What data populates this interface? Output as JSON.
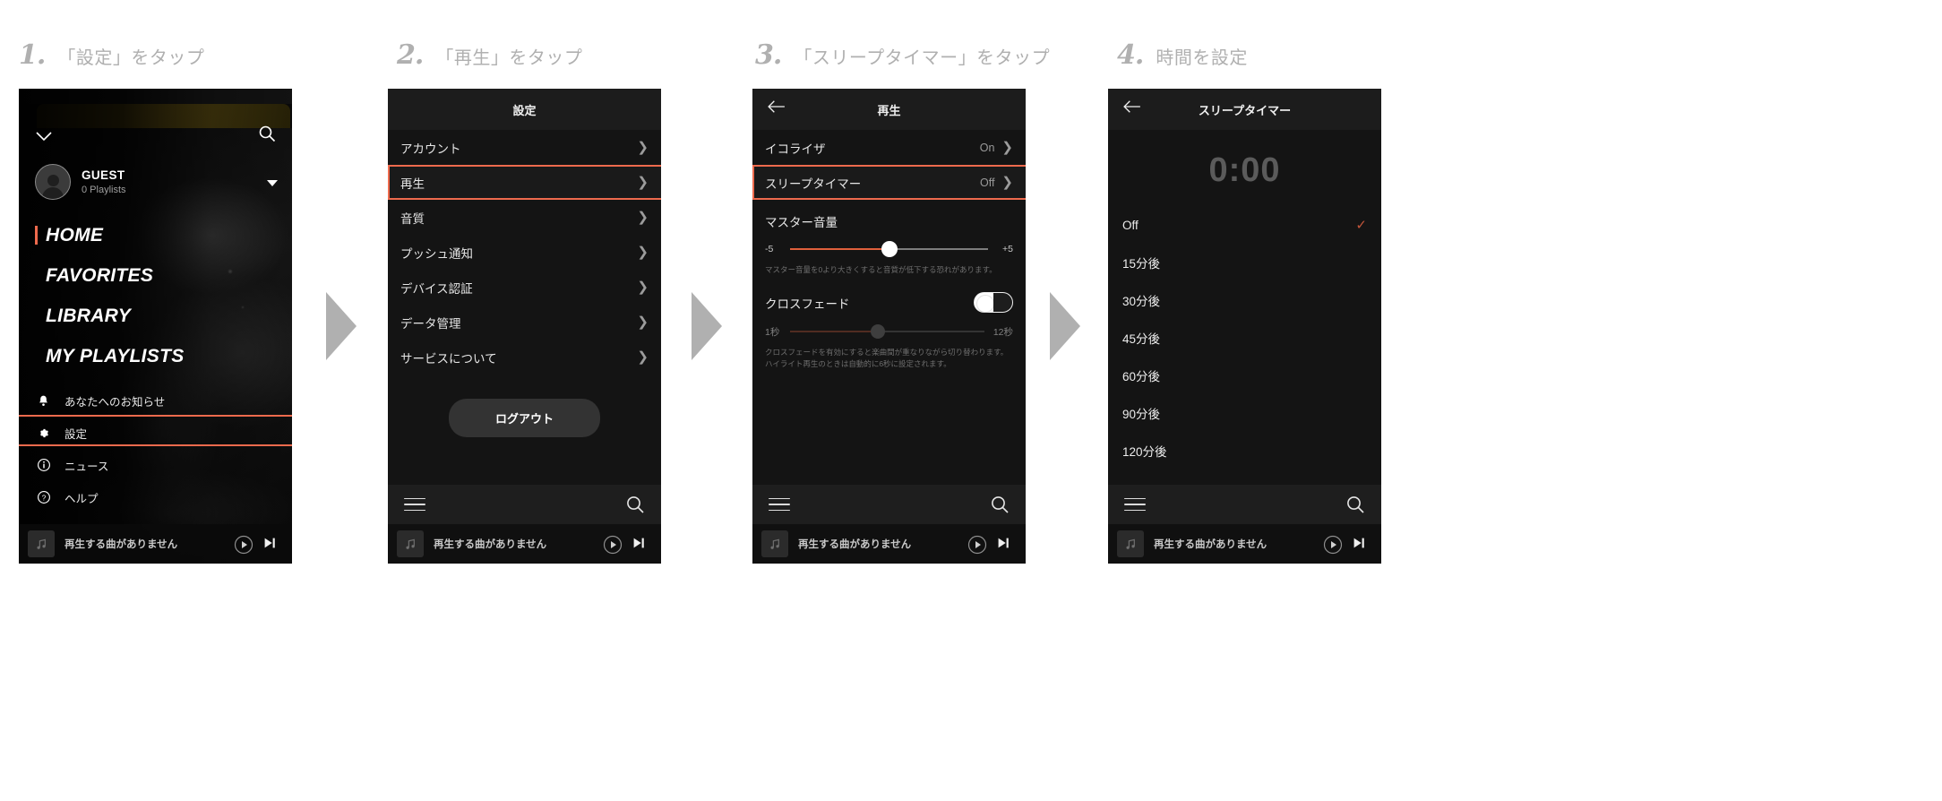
{
  "steps": [
    {
      "num": "1.",
      "text": "「設定」をタップ"
    },
    {
      "num": "2.",
      "text": "「再生」をタップ"
    },
    {
      "num": "3.",
      "text": "「スリープタイマー」をタップ"
    },
    {
      "num": "4.",
      "text": "時間を設定"
    }
  ],
  "accent": "#ee6a4d",
  "phone1": {
    "user": {
      "name": "GUEST",
      "playlists": "0 Playlists"
    },
    "big_nav": [
      {
        "label": "HOME",
        "active": true
      },
      {
        "label": "FAVORITES",
        "active": false
      },
      {
        "label": "LIBRARY",
        "active": false
      },
      {
        "label": "MY PLAYLISTS",
        "active": false
      }
    ],
    "small_nav": [
      {
        "label": "あなたへのお知らせ",
        "icon": "bell-icon"
      },
      {
        "label": "設定",
        "icon": "gear-icon"
      },
      {
        "label": "ニュース",
        "icon": "info-icon"
      },
      {
        "label": "ヘルプ",
        "icon": "help-icon"
      }
    ],
    "icons": {
      "collapse": "chevron-down-icon",
      "search": "search-icon"
    },
    "miniplayer": {
      "title": "再生する曲がありません"
    }
  },
  "phone2": {
    "title": "設定",
    "rows": [
      {
        "label": "アカウント"
      },
      {
        "label": "再生"
      },
      {
        "label": "音質"
      },
      {
        "label": "プッシュ通知"
      },
      {
        "label": "デバイス認証"
      },
      {
        "label": "データ管理"
      },
      {
        "label": "サービスについて"
      }
    ],
    "logout_label": "ログアウト",
    "miniplayer": {
      "title": "再生する曲がありません"
    }
  },
  "phone3": {
    "title": "再生",
    "rows": [
      {
        "label": "イコライザ",
        "value": "On"
      },
      {
        "label": "スリープタイマー",
        "value": "Off"
      }
    ],
    "master_volume": {
      "label": "マスター音量",
      "min": "-5",
      "max": "+5",
      "value_pct": 50,
      "helper": "マスター音量を0より大きくすると音質が低下する恐れがあります。"
    },
    "crossfade": {
      "label": "クロスフェード",
      "enabled": false,
      "min": "1秒",
      "max": "12秒",
      "value_pct": 45,
      "helper": "クロスフェードを有効にすると楽曲間が重なりながら切り替わります。ハイライト再生のときは自動的に6秒に設定されます。"
    },
    "miniplayer": {
      "title": "再生する曲がありません"
    }
  },
  "phone4": {
    "title": "スリープタイマー",
    "countdown": "0:00",
    "options": [
      {
        "label": "Off",
        "selected": true
      },
      {
        "label": "15分後",
        "selected": false
      },
      {
        "label": "30分後",
        "selected": false
      },
      {
        "label": "45分後",
        "selected": false
      },
      {
        "label": "60分後",
        "selected": false
      },
      {
        "label": "90分後",
        "selected": false
      },
      {
        "label": "120分後",
        "selected": false
      }
    ],
    "miniplayer": {
      "title": "再生する曲がありません"
    }
  }
}
